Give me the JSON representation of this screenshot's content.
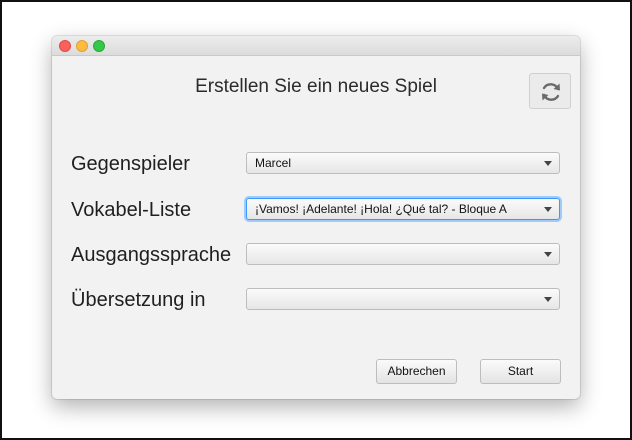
{
  "dialog": {
    "title": "Erstellen Sie ein neues Spiel",
    "refresh_icon": "refresh-icon"
  },
  "form": {
    "opponent": {
      "label": "Gegenspieler",
      "value": "Marcel"
    },
    "vocab_list": {
      "label": "Vokabel-Liste",
      "value": "¡Vamos! ¡Adelante! ¡Hola! ¿Qué tal? - Bloque A"
    },
    "source_language": {
      "label": "Ausgangssprache",
      "value": ""
    },
    "translation": {
      "label": "Übersetzung in",
      "value": ""
    }
  },
  "buttons": {
    "cancel": "Abbrechen",
    "start": "Start"
  },
  "colors": {
    "focus_ring": "#3b99fc",
    "close": "#fc605c",
    "minimize": "#fdbc40",
    "zoom": "#34c84a"
  }
}
